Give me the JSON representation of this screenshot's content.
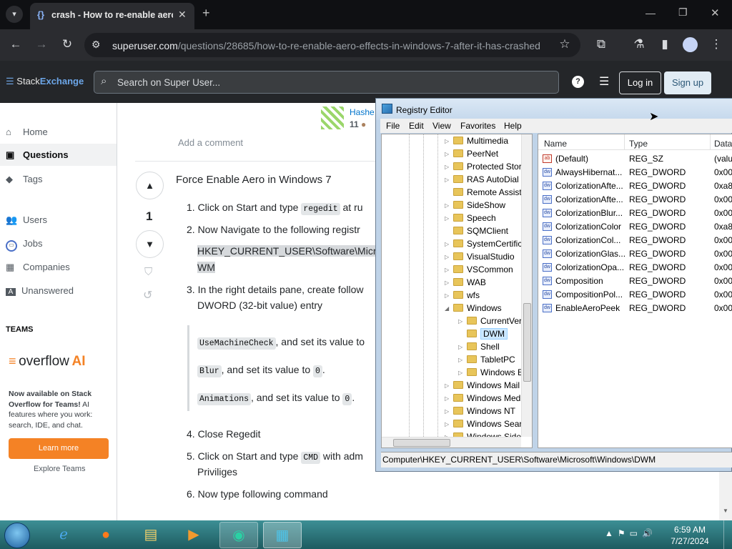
{
  "browser": {
    "tab_title": "crash - How to re-enable aero",
    "url_domain": "superuser.com",
    "url_path": "/questions/28685/how-to-re-enable-aero-effects-in-windows-7-after-it-has-crashed"
  },
  "site": {
    "logo_stack": "Stack",
    "logo_exchange": "Exchange",
    "search_placeholder": "Search on Super User...",
    "login": "Log in",
    "signup": "Sign up"
  },
  "sidebar": {
    "home": "Home",
    "questions": "Questions",
    "tags": "Tags",
    "users": "Users",
    "jobs": "Jobs",
    "companies": "Companies",
    "unanswered": "Unanswered",
    "teams_header": "TEAMS",
    "overflow_brand": "overflow",
    "overflow_ai": "AI",
    "promo_line1": "Now available on Stack Overflow for Teams!",
    "promo_line2": " AI features where you work: search, IDE, and chat.",
    "learn_more": "Learn more",
    "explore_teams": "Explore Teams"
  },
  "post": {
    "user_name": "Hashe",
    "user_rep": "11",
    "add_comment": "Add a comment",
    "vote_count": "1",
    "heading": "Force Enable Aero in Windows 7",
    "step1_a": "1. Click on Start and type ",
    "step1_code": "regedit",
    "step1_b": " at ru",
    "step2": "2. Now Navigate to the following registr",
    "path_line1": "HKEY_CURRENT_USER\\Software\\Micro",
    "path_line2": "WM",
    "step3_line1": "3. In the right details pane, create follow",
    "step3_line2": "DWORD (32-bit value) entry",
    "q1_code": "UseMachineCheck",
    "q1_text": ", and set its value to",
    "q2_code": "Blur",
    "q2_text": ", and set its value to ",
    "q2_val": "0",
    "q2_end": ".",
    "q3_code": "Animations",
    "q3_text": ", and set its value to ",
    "q3_val": "0",
    "q3_end": ".",
    "step4": "4. Close Regedit",
    "step5_a": "5. Click on Start and type ",
    "step5_code": "CMD",
    "step5_b": " with adm",
    "step5_line2": "Priviliges",
    "step6": "6. Now type following command"
  },
  "regedit": {
    "title": "Registry Editor",
    "menu": [
      "File",
      "Edit",
      "View",
      "Favorites",
      "Help"
    ],
    "tree": [
      {
        "label": "Multimedia",
        "expander": "▷"
      },
      {
        "label": "PeerNet",
        "expander": "▷"
      },
      {
        "label": "Protected Stor",
        "expander": "▷"
      },
      {
        "label": "RAS AutoDial",
        "expander": "▷"
      },
      {
        "label": "Remote Assist",
        "expander": ""
      },
      {
        "label": "SideShow",
        "expander": "▷"
      },
      {
        "label": "Speech",
        "expander": "▷"
      },
      {
        "label": "SQMClient",
        "expander": ""
      },
      {
        "label": "SystemCertific",
        "expander": "▷"
      },
      {
        "label": "VisualStudio",
        "expander": "▷"
      },
      {
        "label": "VSCommon",
        "expander": "▷"
      },
      {
        "label": "WAB",
        "expander": "▷"
      },
      {
        "label": "wfs",
        "expander": "▷"
      },
      {
        "label": "Windows",
        "expander": "◢"
      },
      {
        "label": "CurrentVer",
        "expander": "▷"
      },
      {
        "label": "DWM",
        "expander": ""
      },
      {
        "label": "Shell",
        "expander": "▷"
      },
      {
        "label": "TabletPC",
        "expander": "▷"
      },
      {
        "label": "Windows E",
        "expander": "▷"
      },
      {
        "label": "Windows Mail",
        "expander": "▷"
      },
      {
        "label": "Windows Med",
        "expander": "▷"
      },
      {
        "label": "Windows NT",
        "expander": "▷"
      },
      {
        "label": "Windows Sear",
        "expander": "▷"
      },
      {
        "label": "Windows Side",
        "expander": "▷"
      }
    ],
    "columns": [
      "Name",
      "Type",
      "Data"
    ],
    "values": [
      {
        "name": "(Default)",
        "type": "REG_SZ",
        "data": "(valu",
        "icon": "ab"
      },
      {
        "name": "AlwaysHibernat...",
        "type": "REG_DWORD",
        "data": "0x000",
        "icon": "dw"
      },
      {
        "name": "ColorizationAfte...",
        "type": "REG_DWORD",
        "data": "0xa80",
        "icon": "dw"
      },
      {
        "name": "ColorizationAfte...",
        "type": "REG_DWORD",
        "data": "0x000",
        "icon": "dw"
      },
      {
        "name": "ColorizationBlur...",
        "type": "REG_DWORD",
        "data": "0x000",
        "icon": "dw"
      },
      {
        "name": "ColorizationColor",
        "type": "REG_DWORD",
        "data": "0xa80",
        "icon": "dw"
      },
      {
        "name": "ColorizationCol...",
        "type": "REG_DWORD",
        "data": "0x000",
        "icon": "dw"
      },
      {
        "name": "ColorizationGlas...",
        "type": "REG_DWORD",
        "data": "0x000",
        "icon": "dw"
      },
      {
        "name": "ColorizationOpa...",
        "type": "REG_DWORD",
        "data": "0x000",
        "icon": "dw"
      },
      {
        "name": "Composition",
        "type": "REG_DWORD",
        "data": "0x000",
        "icon": "dw"
      },
      {
        "name": "CompositionPol...",
        "type": "REG_DWORD",
        "data": "0x000",
        "icon": "dw"
      },
      {
        "name": "EnableAeroPeek",
        "type": "REG_DWORD",
        "data": "0x000",
        "icon": "dw"
      }
    ],
    "status_path": "Computer\\HKEY_CURRENT_USER\\Software\\Microsoft\\Windows\\DWM"
  },
  "taskbar": {
    "time": "6:59 AM",
    "date": "7/27/2024"
  }
}
